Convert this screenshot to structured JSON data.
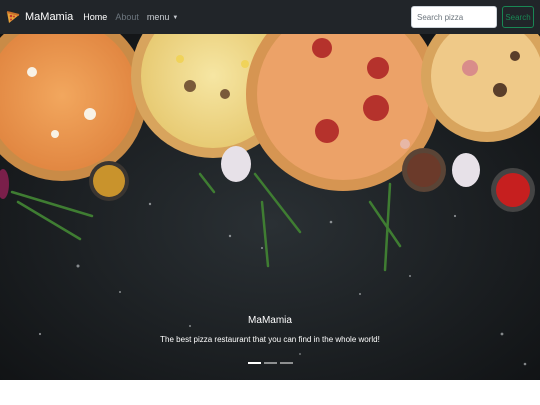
{
  "navbar": {
    "brand_icon": "pizza-slice-icon",
    "brand_name": "MaMamia",
    "links": [
      {
        "label": "Home",
        "state": "active"
      },
      {
        "label": "About",
        "state": "disabled"
      }
    ],
    "dropdown": {
      "label": "menu",
      "icon": "caret-down-icon"
    },
    "search": {
      "placeholder": "Search pizza",
      "value": "",
      "button_label": "Search"
    }
  },
  "carousel": {
    "slide_image": "pizzas-on-dark-stone-table",
    "caption_title": "MaMamia",
    "caption_text": "The best pizza restaurant that you can find in the whole world!",
    "slide_count": 3,
    "active_slide": 1
  },
  "colors": {
    "navbar_bg": "#212529",
    "search_accent": "#198754",
    "hero_bg": "#17191d"
  }
}
